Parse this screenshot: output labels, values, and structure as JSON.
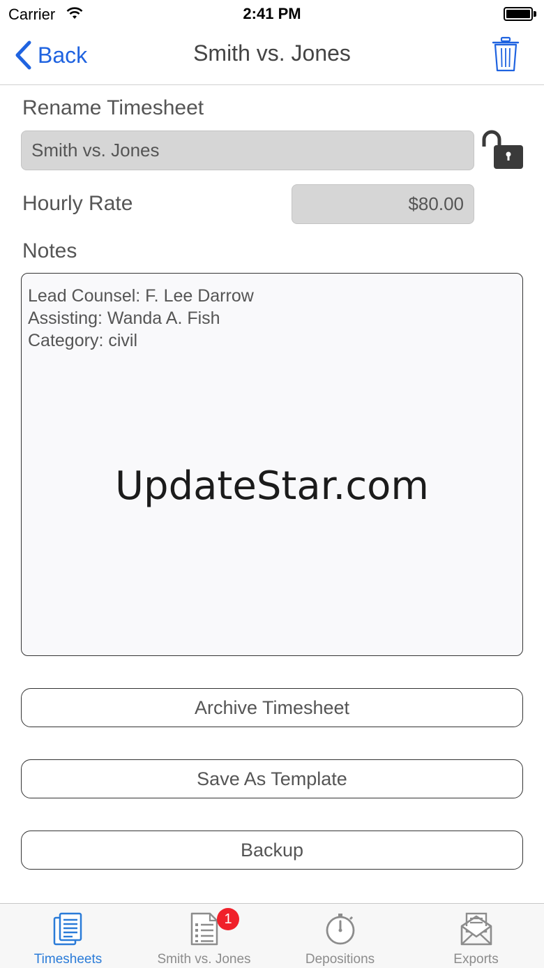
{
  "status_bar": {
    "carrier": "Carrier",
    "time": "2:41 PM"
  },
  "nav": {
    "back_label": "Back",
    "title": "Smith vs. Jones"
  },
  "form": {
    "rename_label": "Rename Timesheet",
    "name_value": "Smith vs. Jones",
    "rate_label": "Hourly Rate",
    "rate_value": "$80.00",
    "notes_label": "Notes",
    "notes_lines": [
      "Lead Counsel: F. Lee Darrow",
      "Assisting: Wanda A. Fish",
      "Category: civil"
    ]
  },
  "watermark": "UpdateStar.com",
  "buttons": {
    "archive": "Archive Timesheet",
    "template": "Save As Template",
    "backup": "Backup"
  },
  "tabs": [
    {
      "label": "Timesheets",
      "icon": "timesheets-icon",
      "active": true
    },
    {
      "label": "Smith vs. Jones",
      "icon": "list-icon",
      "badge": "1"
    },
    {
      "label": "Depositions",
      "icon": "stopwatch-icon"
    },
    {
      "label": "Exports",
      "icon": "envelope-icon"
    }
  ],
  "colors": {
    "accent": "#1f63e0",
    "tab_active": "#2a7bd8",
    "badge": "#f0202a",
    "field_bg": "#d6d6d6"
  }
}
